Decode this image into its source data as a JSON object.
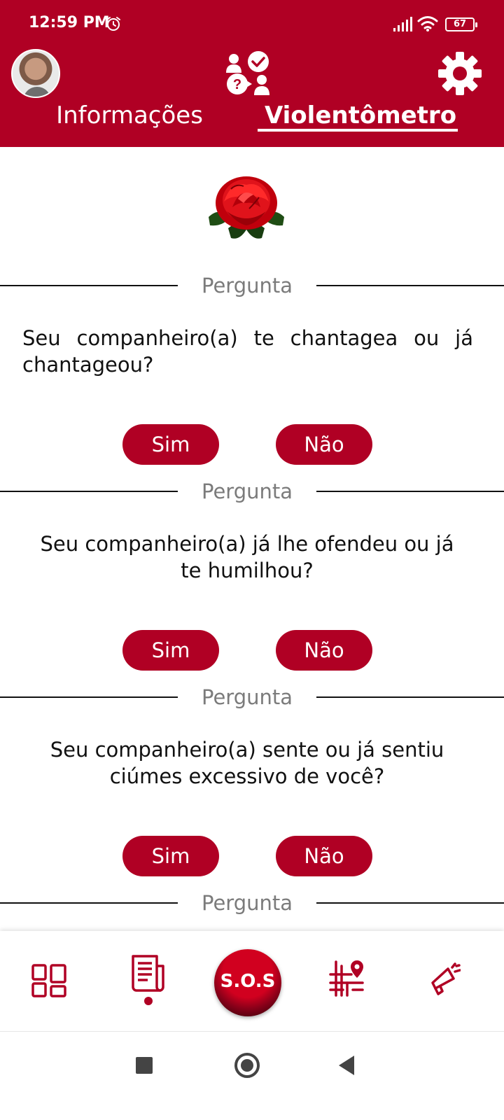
{
  "status_bar": {
    "time": "12:59 PM",
    "battery": "67",
    "icons": [
      "alarm-icon",
      "signal-icon",
      "wifi-icon",
      "battery-icon"
    ]
  },
  "header": {
    "tabs": [
      {
        "label": "Informações",
        "active": false
      },
      {
        "label": "Violentômetro",
        "active": true
      }
    ],
    "icons": [
      "avatar",
      "questions-icon",
      "gear-icon"
    ],
    "color": "#b00024"
  },
  "questions": [
    {
      "label": "Pergunta",
      "text": "Seu companheiro(a) te chantagea ou já chantageou?",
      "yes": "Sim",
      "no": "Não"
    },
    {
      "label": "Pergunta",
      "text": "Seu companheiro(a) já lhe ofendeu ou já te humilhou?",
      "yes": "Sim",
      "no": "Não"
    },
    {
      "label": "Pergunta",
      "text": "Seu companheiro(a) sente ou já sentiu ciúmes excessivo de você?",
      "yes": "Sim",
      "no": "Não"
    },
    {
      "label": "Pergunta"
    }
  ],
  "bottom_nav": {
    "items": [
      "dashboard-icon",
      "news-icon",
      "sos-button",
      "map-icon",
      "megaphone-icon"
    ],
    "sos_label": "S.O.S",
    "active_index": 1
  },
  "system_nav": [
    "recents-button",
    "home-button",
    "back-button"
  ]
}
